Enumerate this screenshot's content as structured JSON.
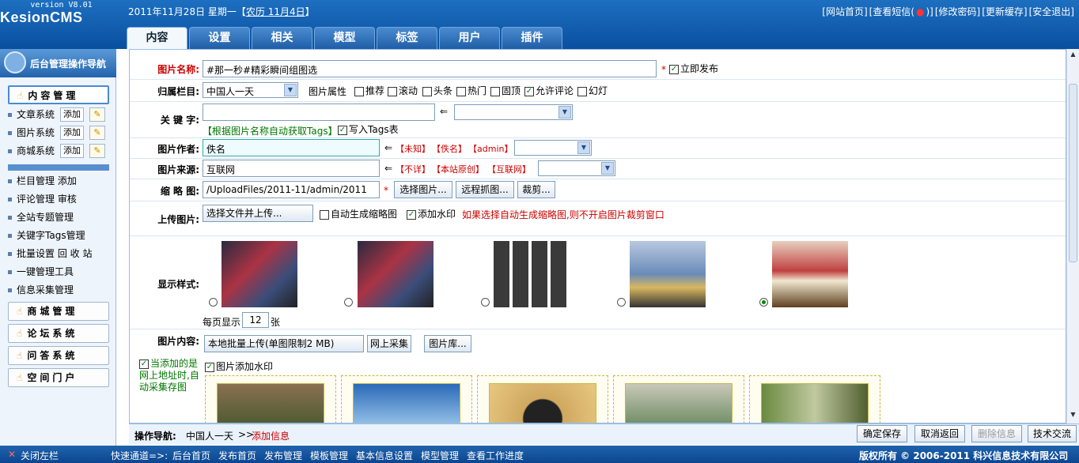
{
  "app": {
    "name": "KesionCMS",
    "version": "version V8.01"
  },
  "header": {
    "date": "2011年11月28日 星期一【",
    "lunar": "农历 11月4日",
    "date_end": "】",
    "links": [
      "[网站首页]",
      "[查看短信(",
      "●",
      ")]",
      "[修改密码]",
      "[更新缓存]",
      "[安全退出]"
    ]
  },
  "tabs": [
    "内容",
    "设置",
    "相关",
    "模型",
    "标签",
    "用户",
    "插件"
  ],
  "sidebar": {
    "header": "后台管理操作导航",
    "content_mgmt": "内容管理",
    "systems": [
      {
        "label": "文章系统",
        "add": "添加"
      },
      {
        "label": "图片系统",
        "add": "添加"
      },
      {
        "label": "商城系统",
        "add": "添加"
      }
    ],
    "items": [
      "栏目管理 添加",
      "评论管理 审核",
      "全站专题管理",
      "关键字Tags管理",
      "批量设置 回 收 站",
      "一键管理工具",
      "信息采集管理"
    ],
    "groups": [
      "商城管理",
      "论坛系统",
      "问答系统",
      "空间门户"
    ]
  },
  "form": {
    "title_label": "图片名称:",
    "title_value": "#那一秒#精彩瞬间组图选",
    "required": "*",
    "publish": "立即发布",
    "category_label": "归属栏目:",
    "category_value": "中国人一天",
    "attr_label": "图片属性",
    "attrs": [
      {
        "label": "推荐",
        "checked": false
      },
      {
        "label": "滚动",
        "checked": false
      },
      {
        "label": "头条",
        "checked": false
      },
      {
        "label": "热门",
        "checked": false
      },
      {
        "label": "固顶",
        "checked": false
      },
      {
        "label": "允许评论",
        "checked": true
      },
      {
        "label": "幻灯",
        "checked": false
      }
    ],
    "keyword_label": "关 键 字:",
    "arrow": "⇐",
    "auto_tags": "【根据图片名称自动获取Tags】",
    "write_tags": "写入Tags表",
    "author_label": "图片作者:",
    "author_value": "佚名",
    "author_opts": [
      "【未知】",
      "【佚名】",
      "【admin】"
    ],
    "source_label": "图片来源:",
    "source_value": "互联网",
    "source_opts": [
      "【不详】",
      "【本站原创】",
      "【互联网】"
    ],
    "thumb_label": "缩 略 图:",
    "thumb_value": "/UploadFiles/2011-11/admin/2011",
    "thumb_btns": [
      "选择图片...",
      "远程抓图...",
      "裁剪..."
    ],
    "upload_label": "上传图片:",
    "upload_btn": "选择文件并上传...",
    "auto_thumb": "自动生成缩略图",
    "watermark": "添加水印",
    "upload_tip": "如果选择自动生成缩略图,则不开启图片裁剪窗口",
    "style_label": "显示样式:",
    "per_page_pre": "每页显示",
    "per_page": "12",
    "per_page_post": "张",
    "content_label": "图片内容:",
    "content_btns": [
      "本地批量上传(单图限制2 MB)",
      "网上采集",
      "图片库..."
    ],
    "remote_note": "当添加的是网上地址时,自动采集存图",
    "pic_watermark": "图片添加水印"
  },
  "bottom": {
    "nav_label": "操作导航:",
    "nav_path": "中国人一天",
    "nav_sep": ">>",
    "nav_action": "添加信息",
    "buttons": [
      "确定保存",
      "取消返回",
      "删除信息",
      "技术交流"
    ]
  },
  "footer": {
    "close": "关闭左栏",
    "quick": "快速通道=>:",
    "links": [
      "后台首页",
      "发布首页",
      "发布管理",
      "模板管理",
      "基本信息设置",
      "模型管理",
      "查看工作进度"
    ],
    "copyright": "版权所有 © 2006-2011 科兴信息技术有限公司"
  },
  "colors": {
    "brand": "#0a4fa0",
    "accent": "#c00"
  }
}
